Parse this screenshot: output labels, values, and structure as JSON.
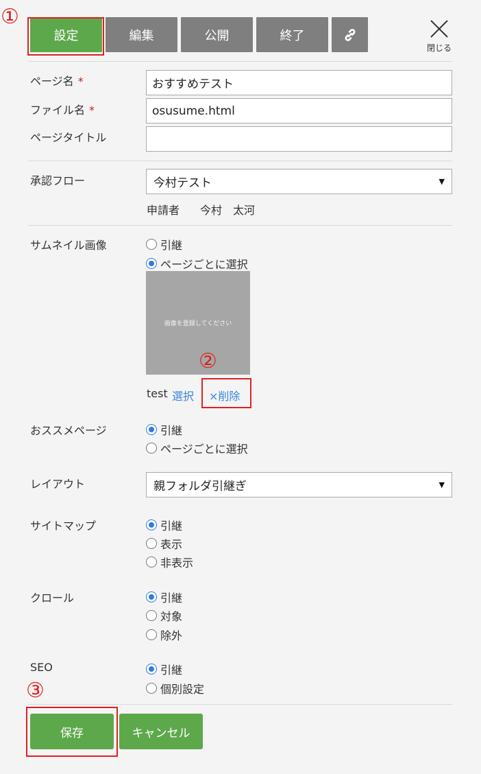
{
  "toolbar": {
    "settings_label": "設定",
    "edit_label": "編集",
    "publish_label": "公開",
    "end_label": "終了",
    "close_label": "閉じる"
  },
  "markers": {
    "one": "①",
    "two": "②",
    "three": "③"
  },
  "form": {
    "page_name": {
      "label": "ページ名",
      "required": "*",
      "value": "おすすめテスト"
    },
    "file_name": {
      "label": "ファイル名",
      "required": "*",
      "value": "osusume.html"
    },
    "page_title": {
      "label": "ページタイトル",
      "value": ""
    },
    "approval_flow": {
      "label": "承認フロー",
      "selected": "今村テスト",
      "applicant_label": "申請者",
      "applicant_name": "今村　太河"
    },
    "thumbnail": {
      "label": "サムネイル画像",
      "options": [
        "引継",
        "ページごとに選択"
      ],
      "selected_index": 1,
      "placeholder": "画像を登録してください",
      "file_name": "test",
      "select_link": "選択",
      "delete_link": "×削除"
    },
    "recommended": {
      "label": "おススメページ",
      "options": [
        "引継",
        "ページごとに選択"
      ],
      "selected_index": 0
    },
    "layout": {
      "label": "レイアウト",
      "selected": "親フォルダ引継ぎ"
    },
    "sitemap": {
      "label": "サイトマップ",
      "options": [
        "引継",
        "表示",
        "非表示"
      ],
      "selected_index": 0
    },
    "crawl": {
      "label": "クロール",
      "options": [
        "引継",
        "対象",
        "除外"
      ],
      "selected_index": 0
    },
    "seo": {
      "label": "SEO",
      "options": [
        "引継",
        "個別設定"
      ],
      "selected_index": 0
    }
  },
  "footer": {
    "save_label": "保存",
    "cancel_label": "キャンセル"
  },
  "colors": {
    "accent_green": "#5ea84c",
    "toolbar_gray": "#7f7f7f",
    "annotation_red": "#e02020",
    "link_blue": "#3a87d8",
    "radio_blue": "#2f7be0"
  }
}
